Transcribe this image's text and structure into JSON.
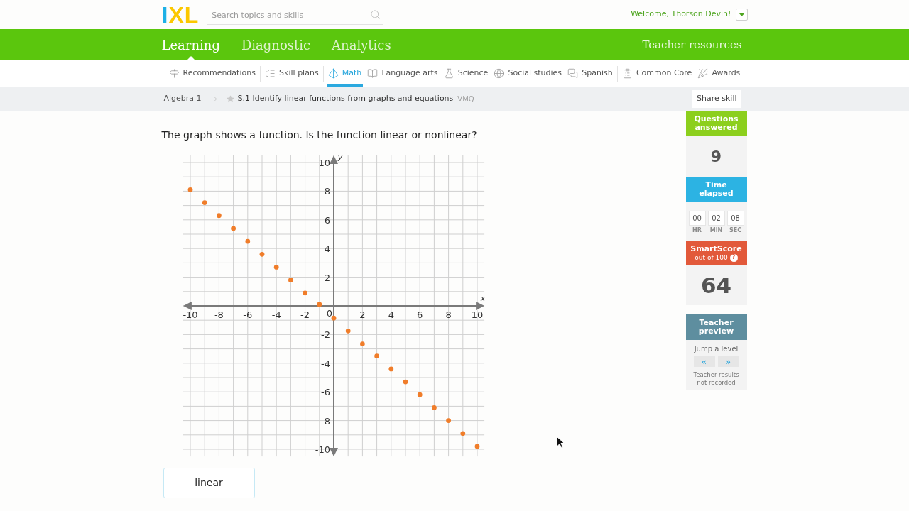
{
  "header": {
    "logo": "IXL",
    "search": {
      "placeholder": "Search topics and skills"
    },
    "welcome": "Welcome, Thorson Devin!"
  },
  "main_nav": {
    "items": [
      {
        "label": "Learning",
        "selected": true
      },
      {
        "label": "Diagnostic",
        "selected": false
      },
      {
        "label": "Analytics",
        "selected": false
      }
    ],
    "right_link": "Teacher resources"
  },
  "subject_nav": {
    "groups": [
      {
        "items": [
          {
            "label": "Recommendations",
            "selected": false
          }
        ]
      },
      {
        "items": [
          {
            "label": "Skill plans",
            "selected": false
          }
        ]
      },
      {
        "items": [
          {
            "label": "Math",
            "selected": true
          },
          {
            "label": "Language arts",
            "selected": false
          },
          {
            "label": "Science",
            "selected": false
          },
          {
            "label": "Social studies",
            "selected": false
          },
          {
            "label": "Spanish",
            "selected": false
          }
        ]
      },
      {
        "items": [
          {
            "label": "Common Core",
            "selected": false
          },
          {
            "label": "Awards",
            "selected": false
          }
        ]
      }
    ]
  },
  "breadcrumb": {
    "course": "Algebra 1",
    "skill": {
      "title": "S.1 Identify linear functions from graphs and equations",
      "starred": false,
      "code": "VMQ"
    },
    "share_button": "Share skill"
  },
  "question": {
    "prompt": "The graph shows a function. Is the function linear or nonlinear?",
    "chart_data": {
      "type": "scatter",
      "xlabel": "x",
      "ylabel": "y",
      "xlim": [
        -10.5,
        10.5
      ],
      "ylim": [
        -10.5,
        10.5
      ],
      "xticks": [
        -10,
        -8,
        -6,
        -4,
        -2,
        0,
        2,
        4,
        6,
        8,
        10
      ],
      "yticks": [
        -10,
        -8,
        -6,
        -4,
        -2,
        2,
        4,
        6,
        8,
        10
      ],
      "grid": true,
      "color": "#f07d2a",
      "x": [
        -10,
        -9,
        -8,
        -7,
        -6,
        -5,
        -4,
        -3,
        -2,
        -1,
        0,
        1,
        2,
        3,
        4,
        5,
        6,
        7,
        8,
        9,
        10
      ],
      "values": [
        8.1,
        7.2,
        6.3,
        5.4,
        4.5,
        3.6,
        2.7,
        1.8,
        0.9,
        0.1,
        -0.85,
        -1.75,
        -2.65,
        -3.5,
        -4.4,
        -5.3,
        -6.2,
        -7.1,
        -8,
        -8.9,
        -9.8
      ]
    },
    "choices": [
      {
        "label": "linear"
      }
    ]
  },
  "sidebar": {
    "questions_answered": {
      "title": "Questions answered",
      "value": "9"
    },
    "time_elapsed": {
      "title": "Time elapsed",
      "units": [
        {
          "value": "00",
          "label": "HR"
        },
        {
          "value": "02",
          "label": "MIN"
        },
        {
          "value": "08",
          "label": "SEC"
        }
      ]
    },
    "smartscore": {
      "title": "SmartScore",
      "subtitle": "out of 100",
      "help": "?",
      "value": "64"
    },
    "teacher_preview": {
      "title": "Teacher preview",
      "jump_label": "Jump a level",
      "back": "«",
      "forward": "»",
      "note": "Teacher results not recorded"
    }
  }
}
